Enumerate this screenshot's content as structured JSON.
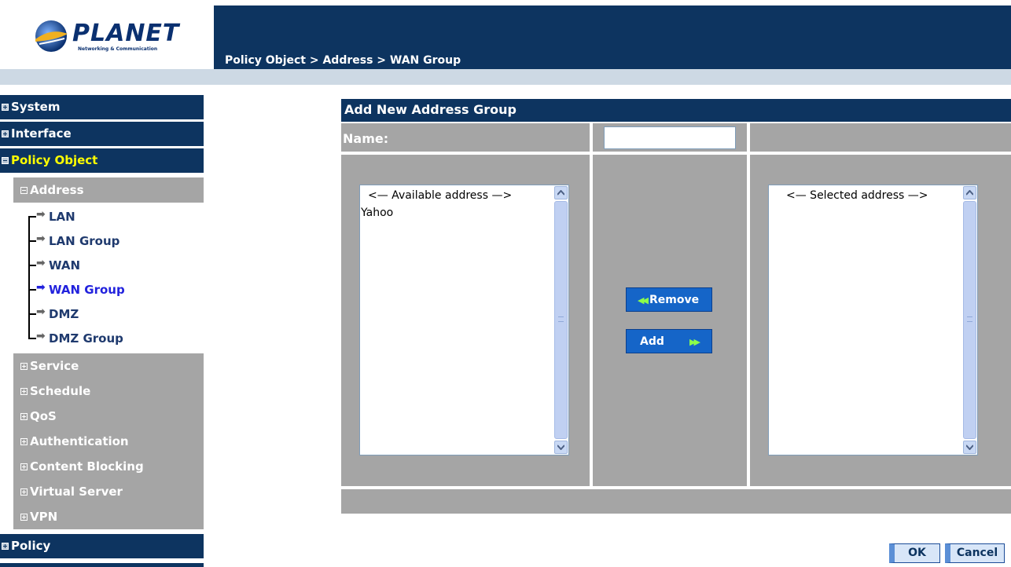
{
  "header": {
    "logo_name": "PLANET",
    "logo_tagline": "Networking & Communication",
    "breadcrumb": "Policy Object > Address > WAN Group"
  },
  "sidebar": {
    "top_items": [
      {
        "label": "System",
        "expanded": false
      },
      {
        "label": "Interface",
        "expanded": false
      },
      {
        "label": "Policy Object",
        "expanded": true,
        "active": true
      },
      {
        "label": "Policy",
        "expanded": false
      }
    ],
    "address": {
      "label": "Address",
      "expanded": true
    },
    "address_children": [
      "LAN",
      "LAN Group",
      "WAN",
      "WAN Group",
      "DMZ",
      "DMZ Group"
    ],
    "current_child": "WAN Group",
    "sub_items": [
      "Service",
      "Schedule",
      "QoS",
      "Authentication",
      "Content Blocking",
      "Virtual Server",
      "VPN"
    ]
  },
  "panel": {
    "title": "Add New Address Group",
    "name_label": "Name:",
    "name_value": "",
    "available_header": "<— Available address —>",
    "available_items": [
      "Yahoo"
    ],
    "selected_header": "<— Selected address —>",
    "selected_items": [],
    "remove_label": "Remove",
    "add_label": "Add"
  },
  "actions": {
    "ok_label": "OK",
    "cancel_label": "Cancel"
  },
  "colors": {
    "navy": "#0d3460",
    "grey": "#a5a5a5",
    "button_blue": "#1565c8",
    "active_nav": "#ffff00",
    "current_link": "#2222dd"
  },
  "icons": [
    "planet-logo-icon",
    "expand-box-icon",
    "collapse-box-icon",
    "arrow-right-icon",
    "double-chevron-left-icon",
    "double-chevron-right-icon",
    "scroll-up-icon",
    "scroll-down-icon"
  ]
}
